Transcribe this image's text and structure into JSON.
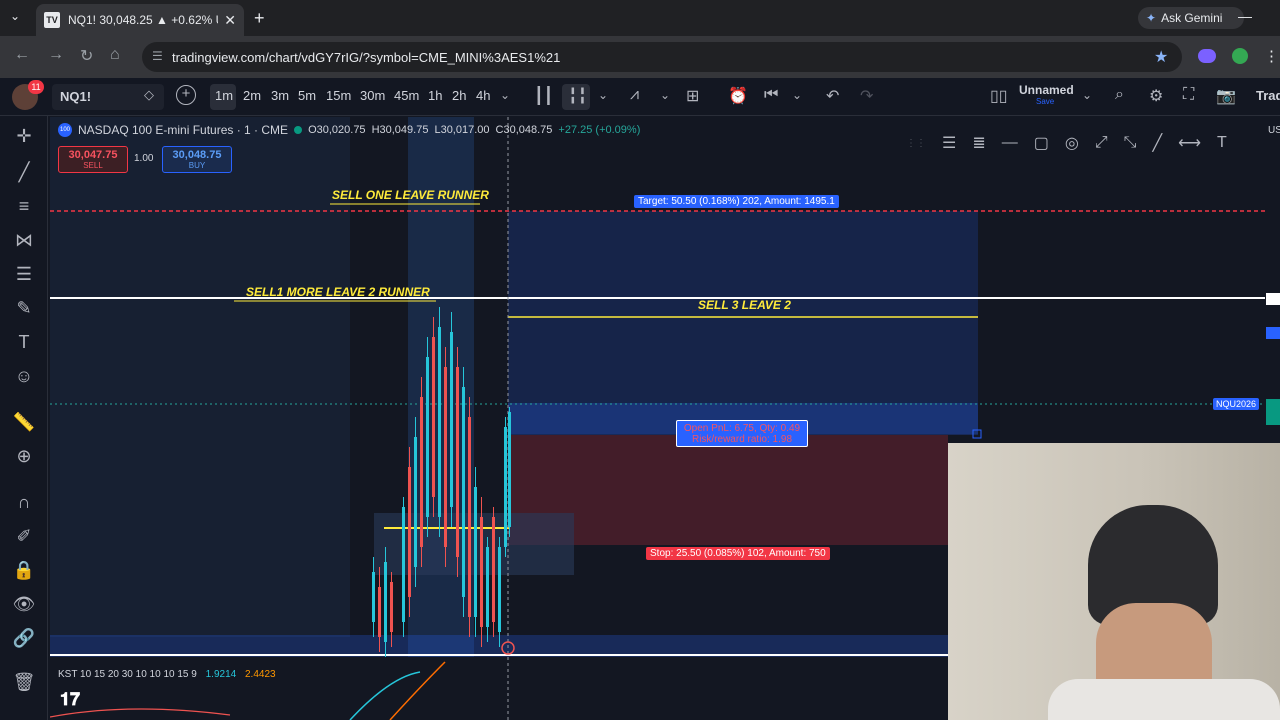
{
  "browser": {
    "tab_title": "NQ1! 30,048.25 ▲ +0.62% Unn",
    "url": "tradingview.com/chart/vdGY7rIG/?symbol=CME_MINI%3AES1%21",
    "ask_gemini": "Ask Gemini"
  },
  "toolbar": {
    "notification_count": "11",
    "symbol": "NQ1!",
    "intervals": [
      "1m",
      "2m",
      "3m",
      "5m",
      "15m",
      "30m",
      "45m",
      "1h",
      "2h",
      "4h"
    ],
    "active_interval": "1m",
    "layout_name": "Unnamed",
    "save_label": "Save",
    "trade_label": "Trad"
  },
  "legend": {
    "icon": "100",
    "instrument": "NASDAQ 100 E-mini Futures · 1 · CME",
    "open": "O30,020.75",
    "high": "H30,049.75",
    "low": "L30,017.00",
    "close": "C30,048.75",
    "change": "+27.25 (+0.09%)",
    "sell_price": "30,047.75",
    "sell_label": "SELL",
    "qty": "1.00",
    "buy_price": "30,048.75",
    "buy_label": "BUY"
  },
  "annotations": {
    "sell_one": "SELL ONE LEAVE RUNNER",
    "sell_more": "SELL1 MORE  LEAVE 2 RUNNER",
    "sell_three": "SELL 3 LEAVE 2",
    "target": "Target: 50.50 (0.168%) 202, Amount: 1495.1",
    "open_pnl": "Open PnL: 6.75, Qty: 0.49",
    "risk_reward": "Risk/reward ratio: 1.98",
    "stop": "Stop: 25.50 (0.085%) 102, Amount: 750",
    "contract_tag": "NQU2026",
    "right_axis_partial": "US"
  },
  "indicator": {
    "name": "KST 10 15 20 30 10 10 10 15 9",
    "value1": "1.9214",
    "value2": "2.4423"
  },
  "colors": {
    "bg": "#131722",
    "up": "#26c6da",
    "down": "#ef5350",
    "annotation": "#ffeb3b",
    "target_blue": "#2962ff",
    "stop_red": "#f23645"
  }
}
